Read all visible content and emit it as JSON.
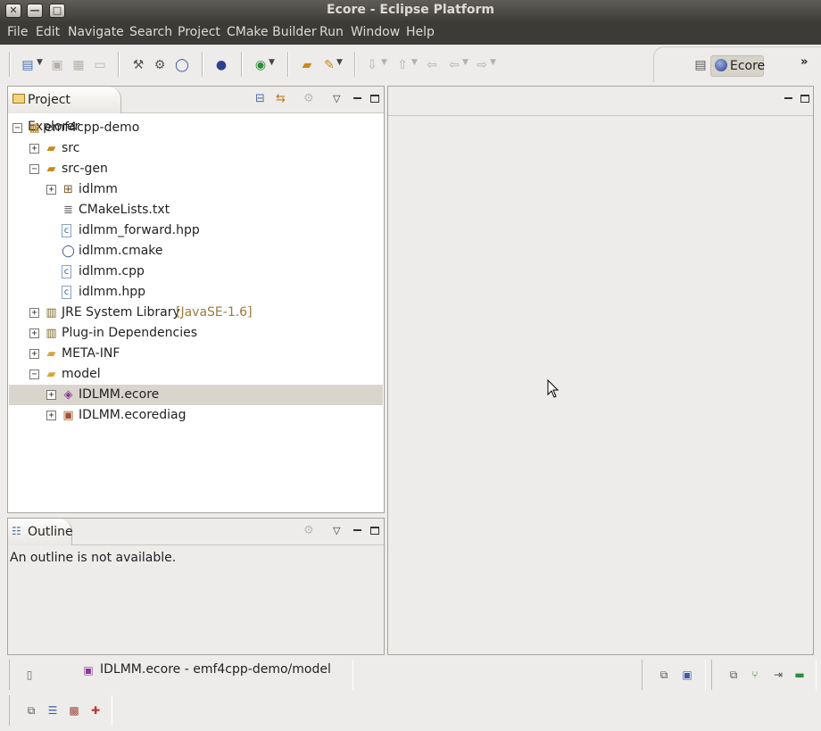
{
  "window": {
    "title": "Ecore - Eclipse Platform",
    "close": "✕",
    "minimize": "—",
    "maximize": "□"
  },
  "menubar": [
    "File",
    "Edit",
    "Navigate",
    "Search",
    "Project",
    "CMake Builder",
    "Run",
    "Window",
    "Help"
  ],
  "perspective": {
    "label": "Ecore",
    "chevron": "»"
  },
  "project_explorer": {
    "title": "Project Explorer",
    "tree": [
      {
        "label": "emf4cpp-demo",
        "depth": 0,
        "twisty": "−",
        "icon": "project-icon"
      },
      {
        "label": "src",
        "depth": 1,
        "twisty": "+",
        "icon": "source-folder-icon"
      },
      {
        "label": "src-gen",
        "depth": 1,
        "twisty": "−",
        "icon": "source-folder-icon"
      },
      {
        "label": "idlmm",
        "depth": 2,
        "twisty": "+",
        "icon": "package-icon"
      },
      {
        "label": "CMakeLists.txt",
        "depth": 2,
        "twisty": "",
        "icon": "text-file-icon"
      },
      {
        "label": "idlmm_forward.hpp",
        "depth": 2,
        "twisty": "",
        "icon": "cpp-header-icon"
      },
      {
        "label": "idlmm.cmake",
        "depth": 2,
        "twisty": "",
        "icon": "cmake-file-icon"
      },
      {
        "label": "idlmm.cpp",
        "depth": 2,
        "twisty": "",
        "icon": "cpp-source-icon"
      },
      {
        "label": "idlmm.hpp",
        "depth": 2,
        "twisty": "",
        "icon": "cpp-header-icon"
      },
      {
        "label": "JRE System Library",
        "decoration": "[JavaSE-1.6]",
        "depth": 1,
        "twisty": "+",
        "icon": "library-icon"
      },
      {
        "label": "Plug-in Dependencies",
        "depth": 1,
        "twisty": "+",
        "icon": "library-icon"
      },
      {
        "label": "META-INF",
        "depth": 1,
        "twisty": "+",
        "icon": "folder-icon"
      },
      {
        "label": "model",
        "depth": 1,
        "twisty": "−",
        "icon": "folder-icon"
      },
      {
        "label": "IDLMM.ecore",
        "depth": 2,
        "twisty": "+",
        "icon": "ecore-file-icon",
        "selected": true
      },
      {
        "label": "IDLMM.ecorediag",
        "depth": 2,
        "twisty": "+",
        "icon": "ecorediag-file-icon"
      }
    ]
  },
  "outline": {
    "title": "Outline",
    "message": "An outline is not available."
  },
  "status": {
    "selection": "IDLMM.ecore - emf4cpp-demo/model"
  },
  "colors": {
    "titlebar": "#4a4843",
    "menubar": "#3c3b37",
    "selection": "#d9d5cd",
    "decoration": "#9c7a3c"
  }
}
